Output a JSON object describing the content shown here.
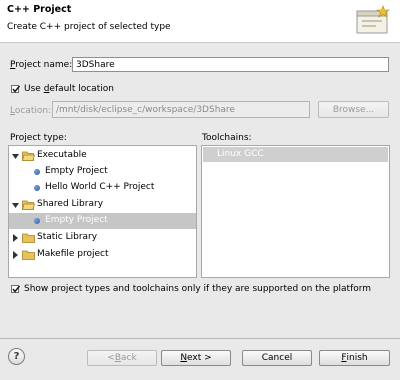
{
  "header": {
    "title": "C++ Project",
    "subtitle": "Create C++ project of selected type"
  },
  "project_name": {
    "label_mnemonic": "P",
    "label_rest": "roject name:",
    "value": "3DShare"
  },
  "default_location": {
    "checked": true,
    "label_pre": "Use ",
    "label_mnemonic": "d",
    "label_post": "efault location"
  },
  "location": {
    "label_mnemonic": "L",
    "label_rest": "ocation:",
    "value": "/mnt/disk/eclipse_c/workspace/3DShare",
    "browse_label": "Browse..."
  },
  "project_type": {
    "heading": "Project type:",
    "items": [
      {
        "label": "Executable",
        "kind": "folder",
        "expanded": true
      },
      {
        "label": "Empty Project",
        "kind": "leaf"
      },
      {
        "label": "Hello World C++ Project",
        "kind": "leaf"
      },
      {
        "label": "Shared Library",
        "kind": "folder",
        "expanded": true
      },
      {
        "label": "Empty Project",
        "kind": "leaf",
        "selected": true
      },
      {
        "label": "Static Library",
        "kind": "folder",
        "expanded": false
      },
      {
        "label": "Makefile project",
        "kind": "folder",
        "expanded": false
      }
    ]
  },
  "toolchains": {
    "heading": "Toolchains:",
    "items": [
      {
        "label": "Linux GCC",
        "selected": true
      }
    ]
  },
  "filter_checkbox": {
    "checked": true,
    "label": "Show project types and toolchains only if they are supported on the platform"
  },
  "buttons": {
    "help_label": "?",
    "back_pre": "< ",
    "back_mnemonic": "B",
    "back_post": "ack",
    "next_mnemonic": "N",
    "next_post": "ext >",
    "cancel_label": "Cancel",
    "finish_mnemonic": "F",
    "finish_post": "inish"
  },
  "colors": {
    "selection": "#c6c6c6",
    "dialog_bg": "#e9e9e9"
  }
}
